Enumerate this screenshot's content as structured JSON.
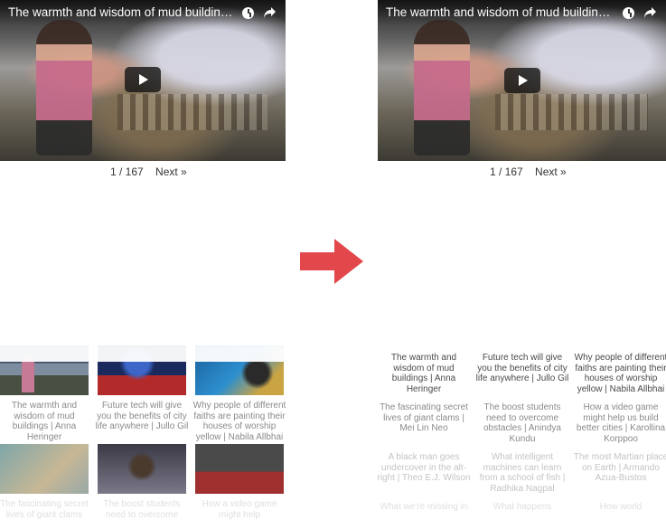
{
  "left_panel": {
    "video_title": "The warmth and wisdom of mud buildings | Anna H...",
    "pager": {
      "page_text": "1 / 167",
      "next_label": "Next »"
    },
    "cards": [
      {
        "caption": "The warmth and wisdom of mud buildings | Anna Heringer"
      },
      {
        "caption": "Future tech will give you the benefits of city life anywhere | Jullo Gil"
      },
      {
        "caption": "Why people of different faiths are painting their houses of worship yellow | Nabila Allbhai"
      },
      {
        "caption": "The fascinating secret lives of giant clams"
      },
      {
        "caption": "The boost students need to overcome"
      },
      {
        "caption": "How a video game might help"
      }
    ]
  },
  "right_panel": {
    "video_title": "The warmth and wisdom of mud buildings | Anna H...",
    "pager": {
      "page_text": "1 / 167",
      "next_label": "Next »"
    },
    "cards": [
      {
        "caption": "The warmth and wisdom of mud buildings | Anna Heringer"
      },
      {
        "caption": "Future tech will give you the benefits of city life anywhere | Jullo Gil"
      },
      {
        "caption": "Why people of different faiths are painting their houses of worship yellow | Nabila Allbhai"
      },
      {
        "caption": "The fascinating secret lives of giant clams | Mei Lin Neo"
      },
      {
        "caption": "The boost students need to overcome obstacles | Anindya Kundu"
      },
      {
        "caption": "How a video game might help us build better cities | Karollina Korppoo"
      },
      {
        "caption": "A black man goes undercover in the alt-right | Theo E.J. Wilson"
      },
      {
        "caption": "What intelligent machines can learn from a school of fish | Radhika Nagpal"
      },
      {
        "caption": "The most Martian place on Earth | Armando Azua-Bustos"
      },
      {
        "caption": "What we're missing in"
      },
      {
        "caption": "What happens"
      },
      {
        "caption": "How world"
      }
    ]
  },
  "colors": {
    "arrow": "#e2484b",
    "caption_text": "#4a4a4a",
    "title_text": "#ffffff"
  },
  "icons": [
    "clock-icon",
    "share-icon",
    "play-icon",
    "arrow-right-icon"
  ]
}
